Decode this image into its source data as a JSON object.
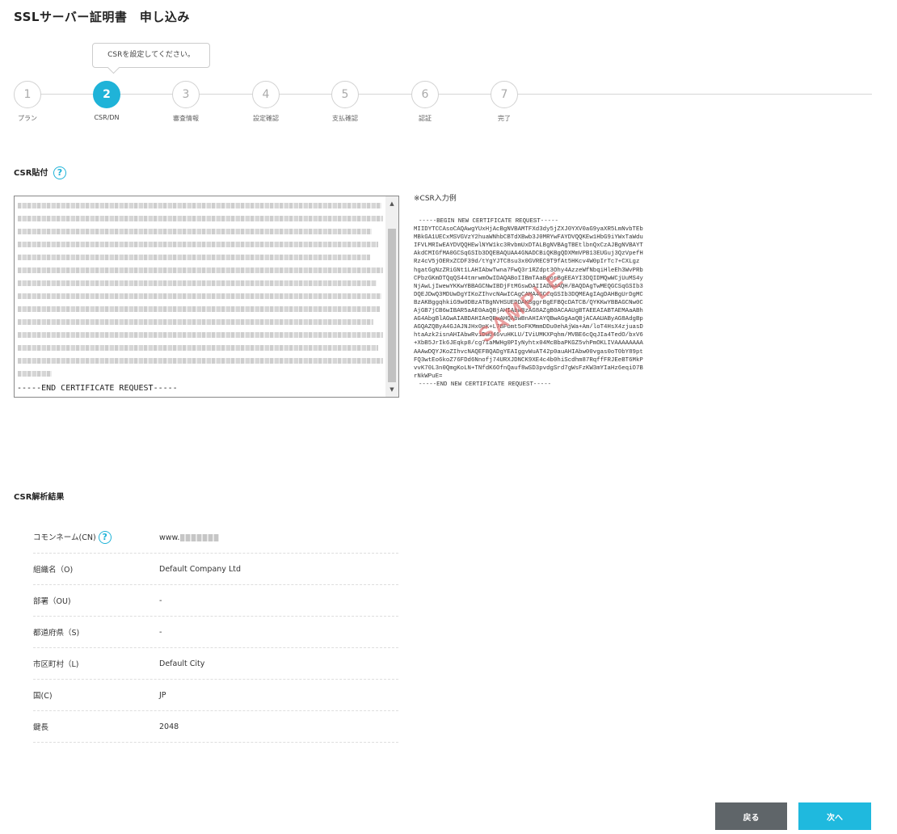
{
  "page": {
    "title": "SSLサーバー証明書　申し込み"
  },
  "tooltip": {
    "text": "CSRを設定してください。"
  },
  "steps": [
    {
      "num": "1",
      "label": "プラン"
    },
    {
      "num": "2",
      "label": "CSR/DN"
    },
    {
      "num": "3",
      "label": "審査情報"
    },
    {
      "num": "4",
      "label": "設定確認"
    },
    {
      "num": "5",
      "label": "支払確認"
    },
    {
      "num": "6",
      "label": "認証"
    },
    {
      "num": "7",
      "label": "完了"
    }
  ],
  "active_step": 2,
  "csr_paste": {
    "title": "CSR貼付",
    "help_icon": "question-icon",
    "end_line": "-----END CERTIFICATE REQUEST-----"
  },
  "csr_example": {
    "label": "※CSR入力例",
    "stamp": "SAMPLE",
    "lines": [
      "-----BEGIN NEW CERTIFICATE REQUEST-----",
      "MIIDYTCCAsoCAQAwgYUxHjAcBgNVBAMTFXd3dy5jZXJ0YXV0aG9yaXR5LmNvbTEb",
      "MBkGA1UECxMSVGVzY2huaWNhbCBTdXBwb3J0MRYwFAYDVQQKEw1HbG9iYWxTaWdu",
      "IFVLMRIwEAYDVQQHEwlNYW1kc3RvbmUxDTALBgNVBAgTBEtlbnQxCzAJBgNVBAYT",
      "AkdCMIGfMA0GCSqGSIb3DQEBAQUAA4GNADCBiQKBgQDXMmVPB13EUGuj3QzVpefH",
      "Rz4cV5jOERxZCDF39d/tYgYJTC8su3x0GVREC9T9fAt5HKcv4W0pIrTc7+CXLgz",
      "hgatGgNzZRiGNt1LAHIAbwTwna7FwQ3r1RZdpt3Ohy4AzzeWfNbqiHleEh3WvPRb",
      "CPbzGKmDTQqQS44tmrwmOwIDAQABoIIBmTAaBgorBgEEAYI3DQIDMQwWCjUuMS4y",
      "NjAwLjIwewYKKwYBBAGCNwIBDjFtMGswDAIIADw4AQH/BAQDAgTwMEQGCSqGSIb3",
      "DQEJDwQ3MDUwDgYIKoZIhvcNAwICAgCAMA4GCCqGSIb3DQMEAgIAgDAHBgUrDgMC",
      "BzAKBggqhkiG9w0DBzATBgNVHSUEDDAKBggrBgEFBQcDATCB/QYKKwYBBAGCNw0C",
      "AjGB7jCB6wIBAR5aAE0AaQBjAHIAbwBzAG8AZgB0ACAAUgBTAEEAIABTAEMAaABh",
      "AG4AbgBlAGwAIABDAHIAeQBwAHQAbwBnAHIAYQBwAGgAaQBjACAAUAByAG8AdgBp",
      "AGQAZQByA4GJAJNJHx0pK+L7BFomt5oFKMmmDDu0ehAjWa+Am/loT4HsX4zjuasD",
      "htaAzk2isnAHIAbwRviDwU46vuHKLU/IViUMKXPqhm/MVBE6cQqJIa4TedO/bxV6",
      "+XbB5JrIk6JEqkp8/cg7IaMWHg0PIyNyhtx04McBbaPKGZ5vhPmOKLIVAAAAAAAA",
      "AAAwDQYJKoZIhvcNAQEFBQADgYEAIggvWuAT42p0auAHIAbw00vgas0oT0bY89pt",
      "FQ3wtEo6koZ76FDd6Nnofj74URXJDNCK9XE4c4b0hiScdhm87RqffFRJEeBT6MkP",
      "vvK70L3n0QmgKoLN+TNfdK6OfnQauf8wSD3pvdgSrd7gWsFzKW3mYIaHz6eqiO7B",
      "rNkWPuE=",
      "-----END NEW CERTIFICATE REQUEST-----"
    ]
  },
  "csr_result": {
    "title": "CSR解析結果",
    "rows": [
      {
        "key": "コモンネーム(CN)",
        "value": "www.",
        "has_help": true,
        "blurred": true
      },
      {
        "key": "組織名（O)",
        "value": "Default Company Ltd"
      },
      {
        "key": "部署（OU)",
        "value": "-"
      },
      {
        "key": "都道府県（S)",
        "value": "-"
      },
      {
        "key": "市区町村（L)",
        "value": "Default City"
      },
      {
        "key": "国(C)",
        "value": "JP"
      },
      {
        "key": "鍵長",
        "value": "2048"
      }
    ]
  },
  "buttons": {
    "back": "戻る",
    "next": "次へ"
  },
  "colors": {
    "accent": "#1fb3d8",
    "back_button": "#5f6569",
    "next_button": "#1fb9de"
  }
}
